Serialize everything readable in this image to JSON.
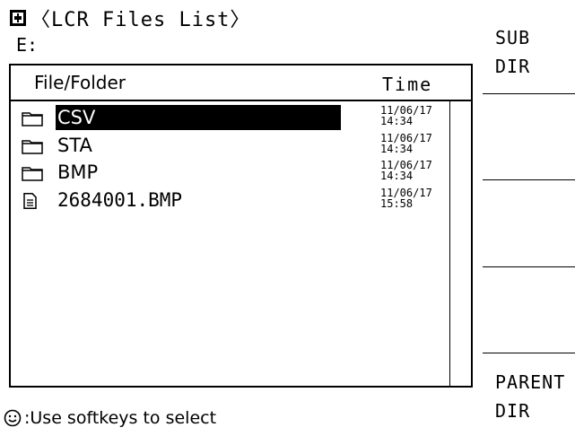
{
  "screen": {
    "title": "〈LCR Files List〉",
    "drive": "E:",
    "columns": {
      "file": "File/Folder",
      "time": "Time"
    },
    "items": [
      {
        "name": "CSV",
        "type": "folder",
        "date": "11/06/17",
        "time": "14:34",
        "selected": true
      },
      {
        "name": "STA",
        "type": "folder",
        "date": "11/06/17",
        "time": "14:34",
        "selected": false
      },
      {
        "name": "BMP",
        "type": "folder",
        "date": "11/06/17",
        "time": "14:34",
        "selected": false
      },
      {
        "name": "2684001.BMP",
        "type": "file",
        "date": "11/06/17",
        "time": "15:58",
        "selected": false
      }
    ],
    "footer": ":Use softkeys to select"
  },
  "softkeys": {
    "sub_dir": {
      "line1": "SUB",
      "line2": "DIR"
    },
    "parent_dir": {
      "line1": "PARENT",
      "line2": "DIR"
    }
  },
  "icons": {
    "title": "save-disk-icon",
    "folder": "folder-icon",
    "file": "file-icon",
    "footer": "smiley-knob-icon"
  }
}
